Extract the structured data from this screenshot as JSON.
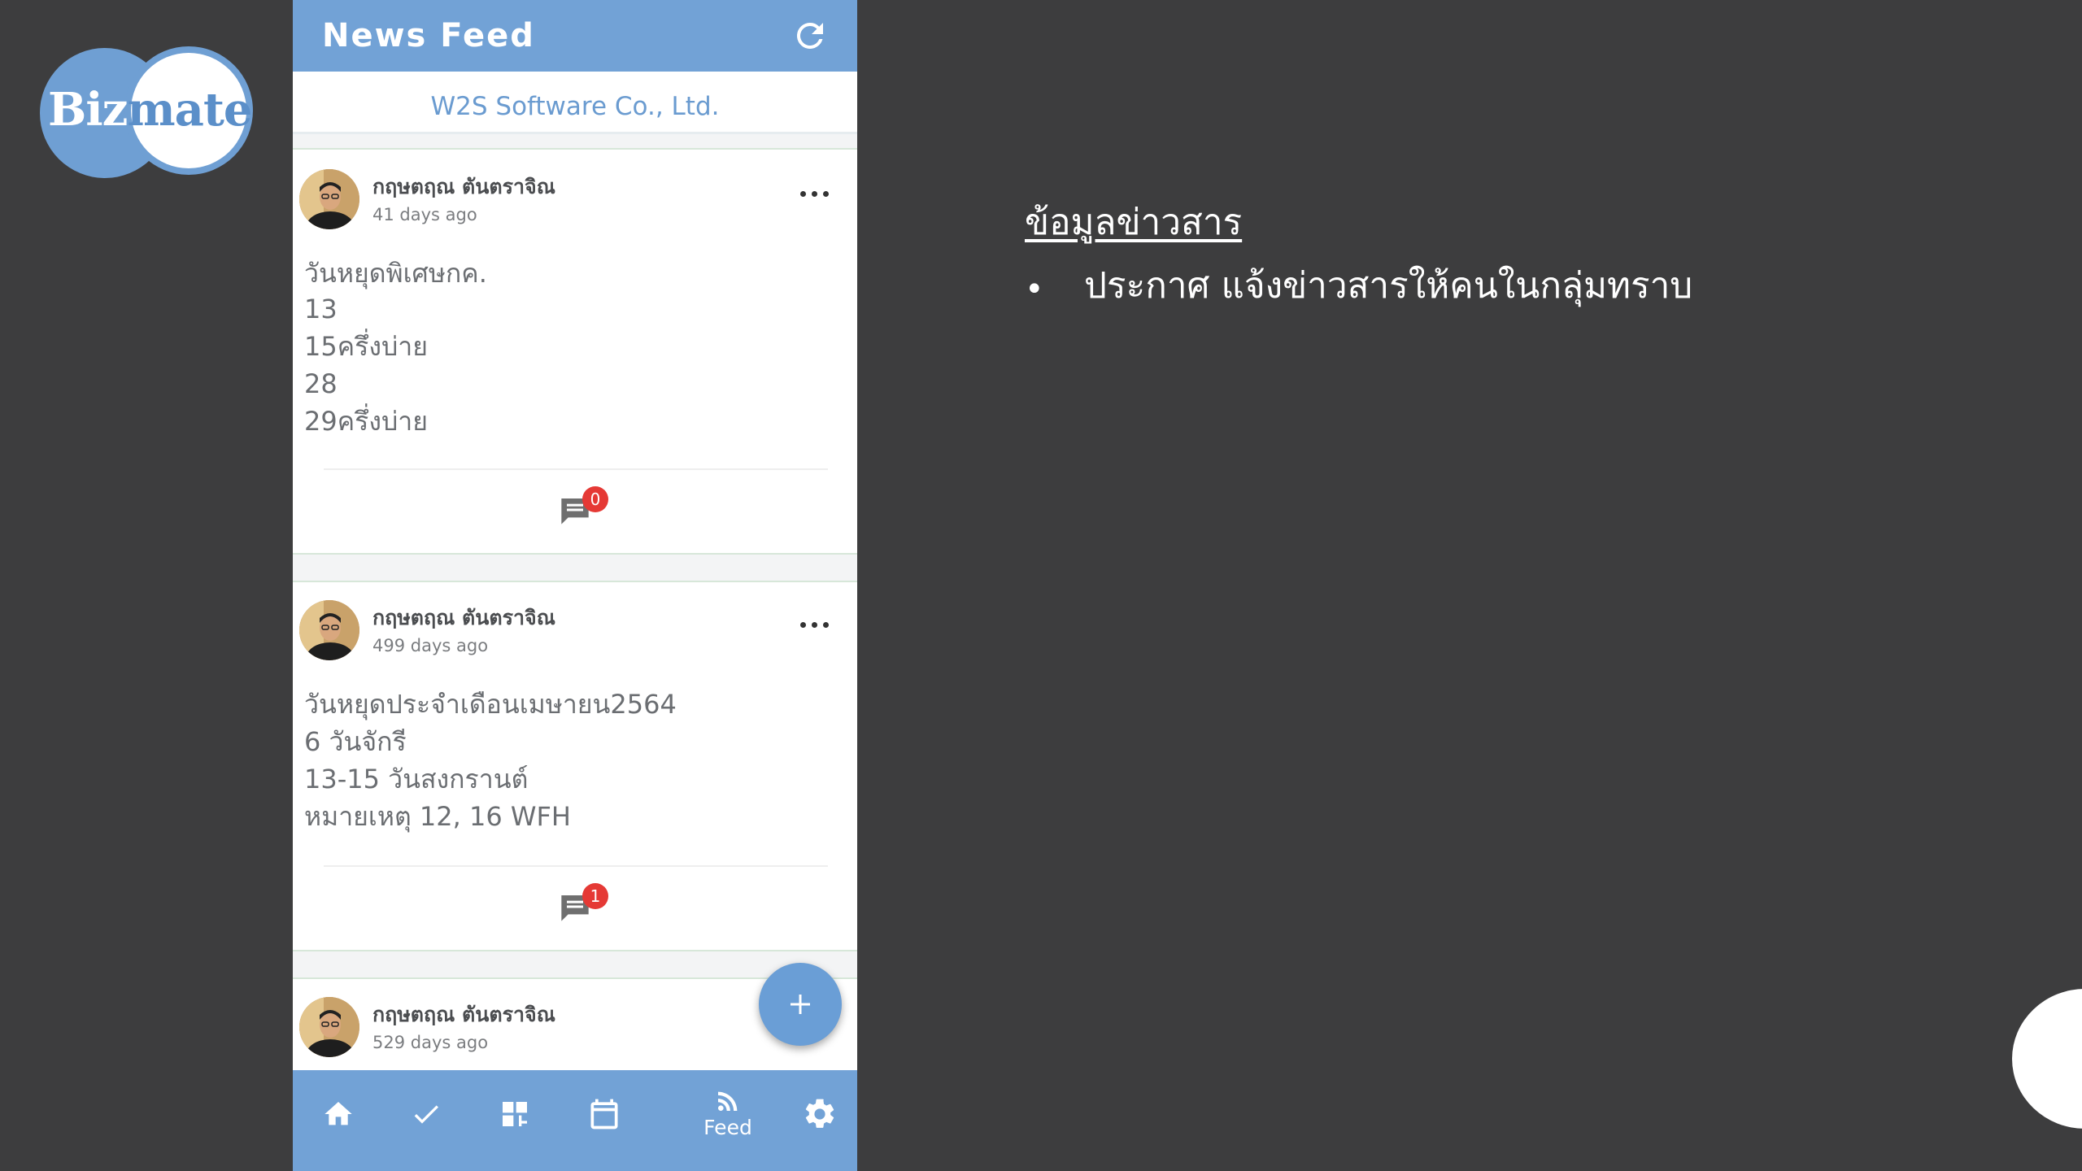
{
  "logo": {
    "part1": "Biz",
    "part2": "mate"
  },
  "app": {
    "title": "News Feed",
    "company": "W2S Software Co., Ltd."
  },
  "posts": [
    {
      "author": "กฤษตฤณ ตันตราจิณ",
      "time": "41 days ago",
      "lines": [
        "วันหยุดพิเศษกค.",
        "13",
        "15ครึ่งบ่าย",
        "28",
        "29ครึ่งบ่าย"
      ],
      "comment_count": "0"
    },
    {
      "author": "กฤษตฤณ ตันตราจิณ",
      "time": "499 days ago",
      "lines": [
        "วันหยุดประจำเดือนเมษายน2564",
        "6 วันจักรี",
        "13-15 วันสงกรานต์",
        "หมายเหตุ 12, 16 WFH"
      ],
      "comment_count": "1"
    },
    {
      "author": "กฤษตฤณ ตันตราจิณ",
      "time": "529 days ago"
    }
  ],
  "nav": {
    "items": [
      "home-icon",
      "check-icon",
      "dashboard-icon",
      "calendar-icon",
      "rss-feed-icon",
      "settings-icon"
    ],
    "feed_label": "Feed"
  },
  "info": {
    "title": "ข้อมูลข่าวสาร",
    "bullet": "•",
    "items": [
      "ประกาศ แจ้งข่าวสารให้คนในกลุ่มทราบ"
    ]
  },
  "colors": {
    "brand_blue": "#72a2d6",
    "company_text": "#6a9bd0",
    "badge_red": "#e53935",
    "background": "#3d3d3e"
  }
}
